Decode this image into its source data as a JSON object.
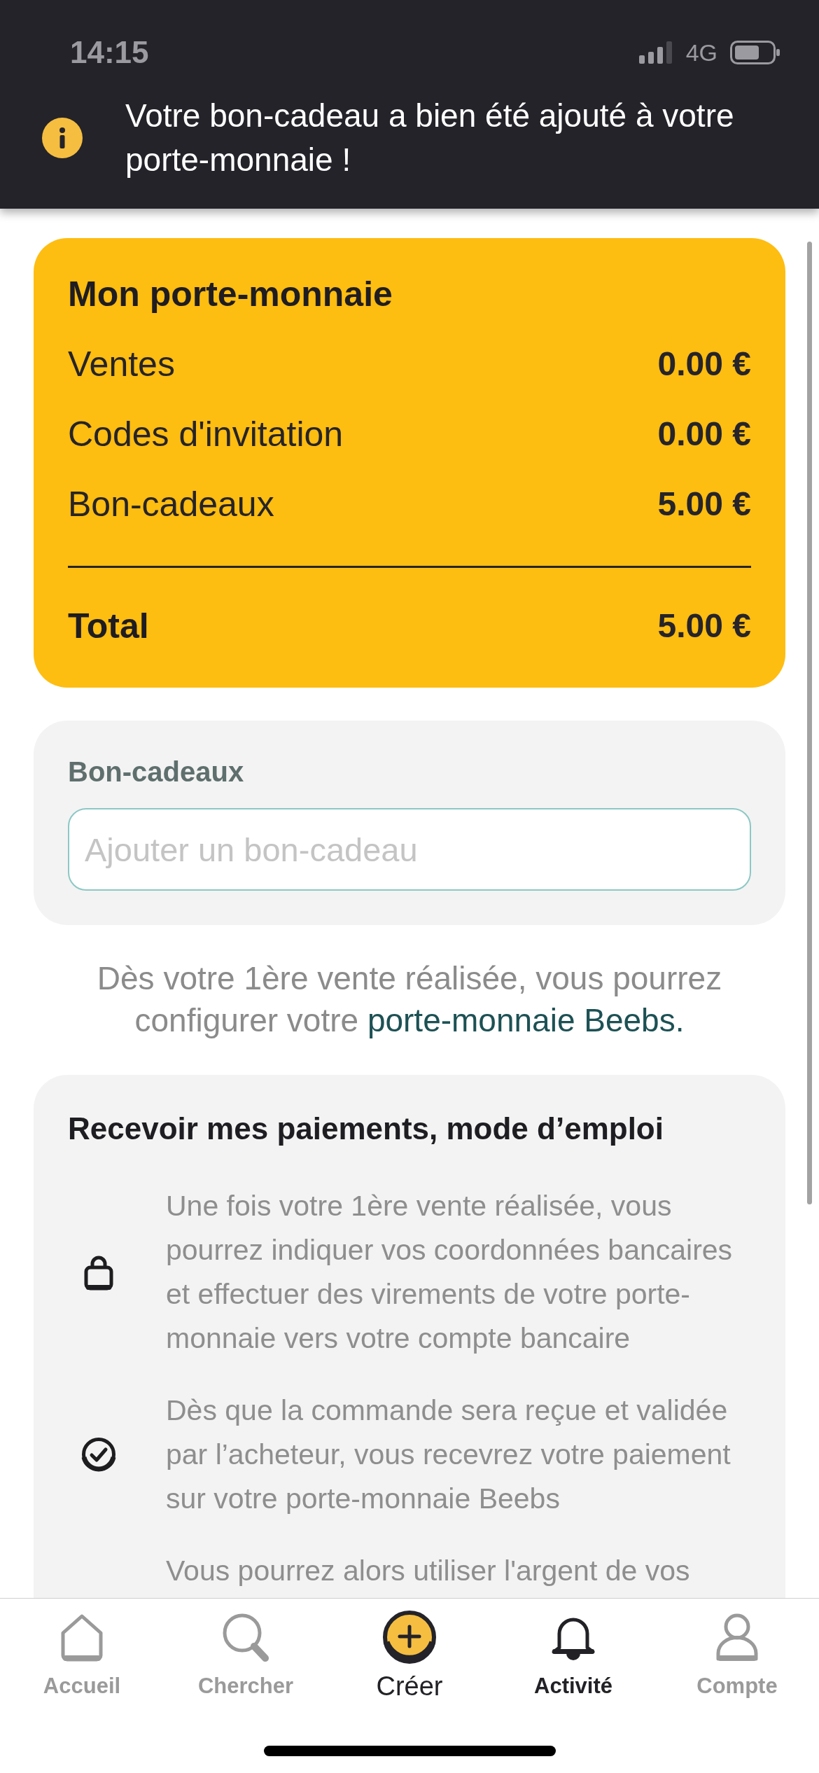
{
  "status_bar": {
    "time": "14:15",
    "network": "4G"
  },
  "notification": {
    "message": "Votre bon-cadeau a bien été ajouté à votre porte-monnaie !"
  },
  "wallet": {
    "title": "Mon porte-monnaie",
    "rows": [
      {
        "label": "Ventes",
        "amount": "0.00 €"
      },
      {
        "label": "Codes d'invitation",
        "amount": "0.00 €"
      },
      {
        "label": "Bon-cadeaux",
        "amount": "5.00 €"
      }
    ],
    "total": {
      "label": "Total",
      "amount": "5.00 €"
    }
  },
  "gift_cards": {
    "label": "Bon-cadeaux",
    "input": {
      "placeholder": "Ajouter un bon-cadeau"
    }
  },
  "info": {
    "text": "Dès votre 1ère vente réalisée, vous pourrez configurer votre",
    "link": "porte-monnaie Beebs."
  },
  "instructions": {
    "title": "Recevoir mes paiements, mode d’emploi",
    "steps": [
      {
        "kind": "lock",
        "text": "Une fois votre 1ère vente réalisée, vous pourrez indiquer vos coordonnées bancaires et effectuer des virements de votre porte-monnaie vers votre compte bancaire"
      },
      {
        "kind": "check",
        "text": "Dès que la commande sera reçue et validée par l’acheteur, vous recevrez votre paiement sur votre porte-monnaie Beebs"
      },
      {
        "text": "Vous pourrez alors utiliser l'argent de vos"
      }
    ]
  },
  "nav": [
    {
      "kind": "home",
      "label": "Accueil",
      "selected": false
    },
    {
      "kind": "search",
      "label": "Chercher",
      "selected": false
    },
    {
      "kind": "create",
      "label": "Créer",
      "selected": false
    },
    {
      "kind": "activity",
      "label": "Activité",
      "selected": true
    },
    {
      "kind": "account",
      "label": "Compte",
      "selected": false
    }
  ]
}
